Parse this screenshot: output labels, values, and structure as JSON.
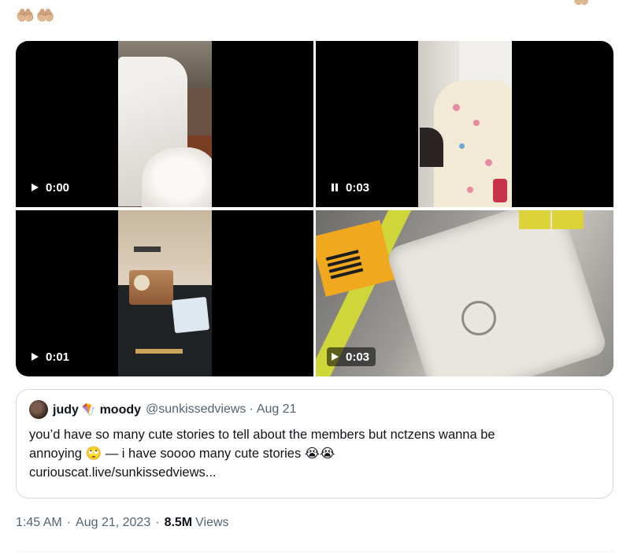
{
  "tweet": {
    "top_emoji": "🤲🏼🤲🏼",
    "corner_emoji": "🤲🏼"
  },
  "media": [
    {
      "time": "0:00",
      "state": "play",
      "scene": "bed"
    },
    {
      "time": "0:03",
      "state": "pause",
      "scene": "blanket"
    },
    {
      "time": "0:01",
      "state": "play",
      "scene": "nightstand"
    },
    {
      "time": "0:03",
      "state": "play",
      "scene": "suitcase"
    }
  ],
  "quote": {
    "name_first": "judy",
    "name_emoji": "🪁",
    "name_second": "moody",
    "handle": "@sunkissedviews",
    "separator": "·",
    "date": "Aug 21",
    "text_line1": "you’d have so many cute stories to tell about the members but nctzens wanna be",
    "text_line2": "annoying 🙄 — i have soooo many cute stories 😭😭",
    "link": "curiouscat.live/sunkissedviews..."
  },
  "meta": {
    "time": "1:45 AM",
    "separator": "·",
    "date": "Aug 21, 2023",
    "views_count": "8.5M",
    "views_label": "Views"
  },
  "colors": {
    "text": "#0f1419",
    "secondary": "#536471",
    "border": "#cfd9de"
  }
}
